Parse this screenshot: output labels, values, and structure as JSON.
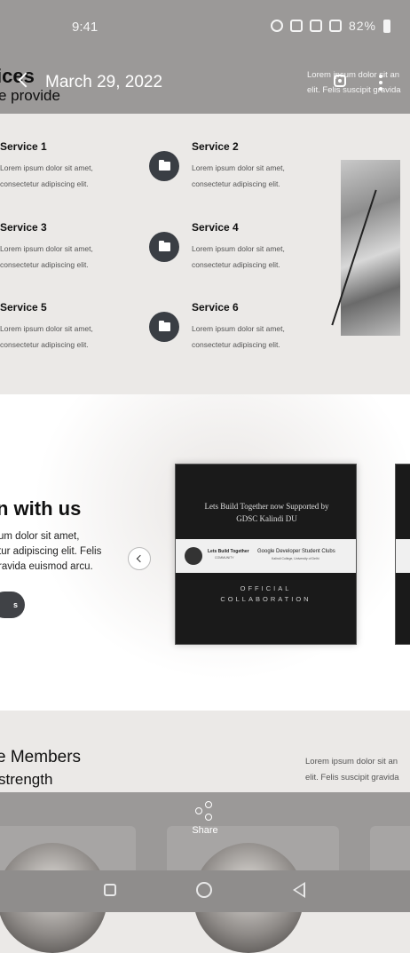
{
  "status": {
    "time": "9:41",
    "battery": "82%"
  },
  "appbar": {
    "date": "March 29, 2022"
  },
  "hero": {
    "title": "ices",
    "subtitle": "e provide",
    "right_lines": [
      "Lorem ipsum dolor sit an",
      "elit. Felis suscipit gravida"
    ]
  },
  "services": [
    {
      "name": "Service 1",
      "text": "Lorem ipsum dolor sit amet, consectetur adipiscing elit."
    },
    {
      "name": "Service 2",
      "text": "Lorem ipsum dolor sit amet, consectetur adipiscing elit."
    },
    {
      "name": "Service 3",
      "text": "Lorem ipsum dolor sit amet, consectetur adipiscing elit."
    },
    {
      "name": "Service 4",
      "text": "Lorem ipsum dolor sit amet, consectetur adipiscing elit."
    },
    {
      "name": "Service 5",
      "text": "Lorem ipsum dolor sit amet, consectetur adipiscing elit."
    },
    {
      "name": "Service 6",
      "text": "Lorem ipsum dolor sit amet, consectetur adipiscing elit."
    }
  ],
  "collab": {
    "heading": "n with us",
    "lines": [
      "um dolor sit amet,",
      "tur adipiscing elit. Felis",
      "ravida euismod arcu."
    ],
    "button_label": "s",
    "card": {
      "tagline_1": "Lets Build Together now Supported by",
      "tagline_2": "GDSC Kalindi DU",
      "partner_1": "Lets Build Together",
      "partner_1_sub": "COMMUNITY",
      "partner_2": "Google Developer Student Clubs",
      "partner_2_sub": "Kalindi College, University of Delhi",
      "official_1": "OFFICIAL",
      "official_2": "COLLABORATION"
    }
  },
  "members": {
    "title": "e Members",
    "subtitle": "strength",
    "right_lines": [
      "Lorem ipsum dolor sit an",
      "elit. Felis suscipit gravida"
    ]
  },
  "share": {
    "label": "Share"
  }
}
